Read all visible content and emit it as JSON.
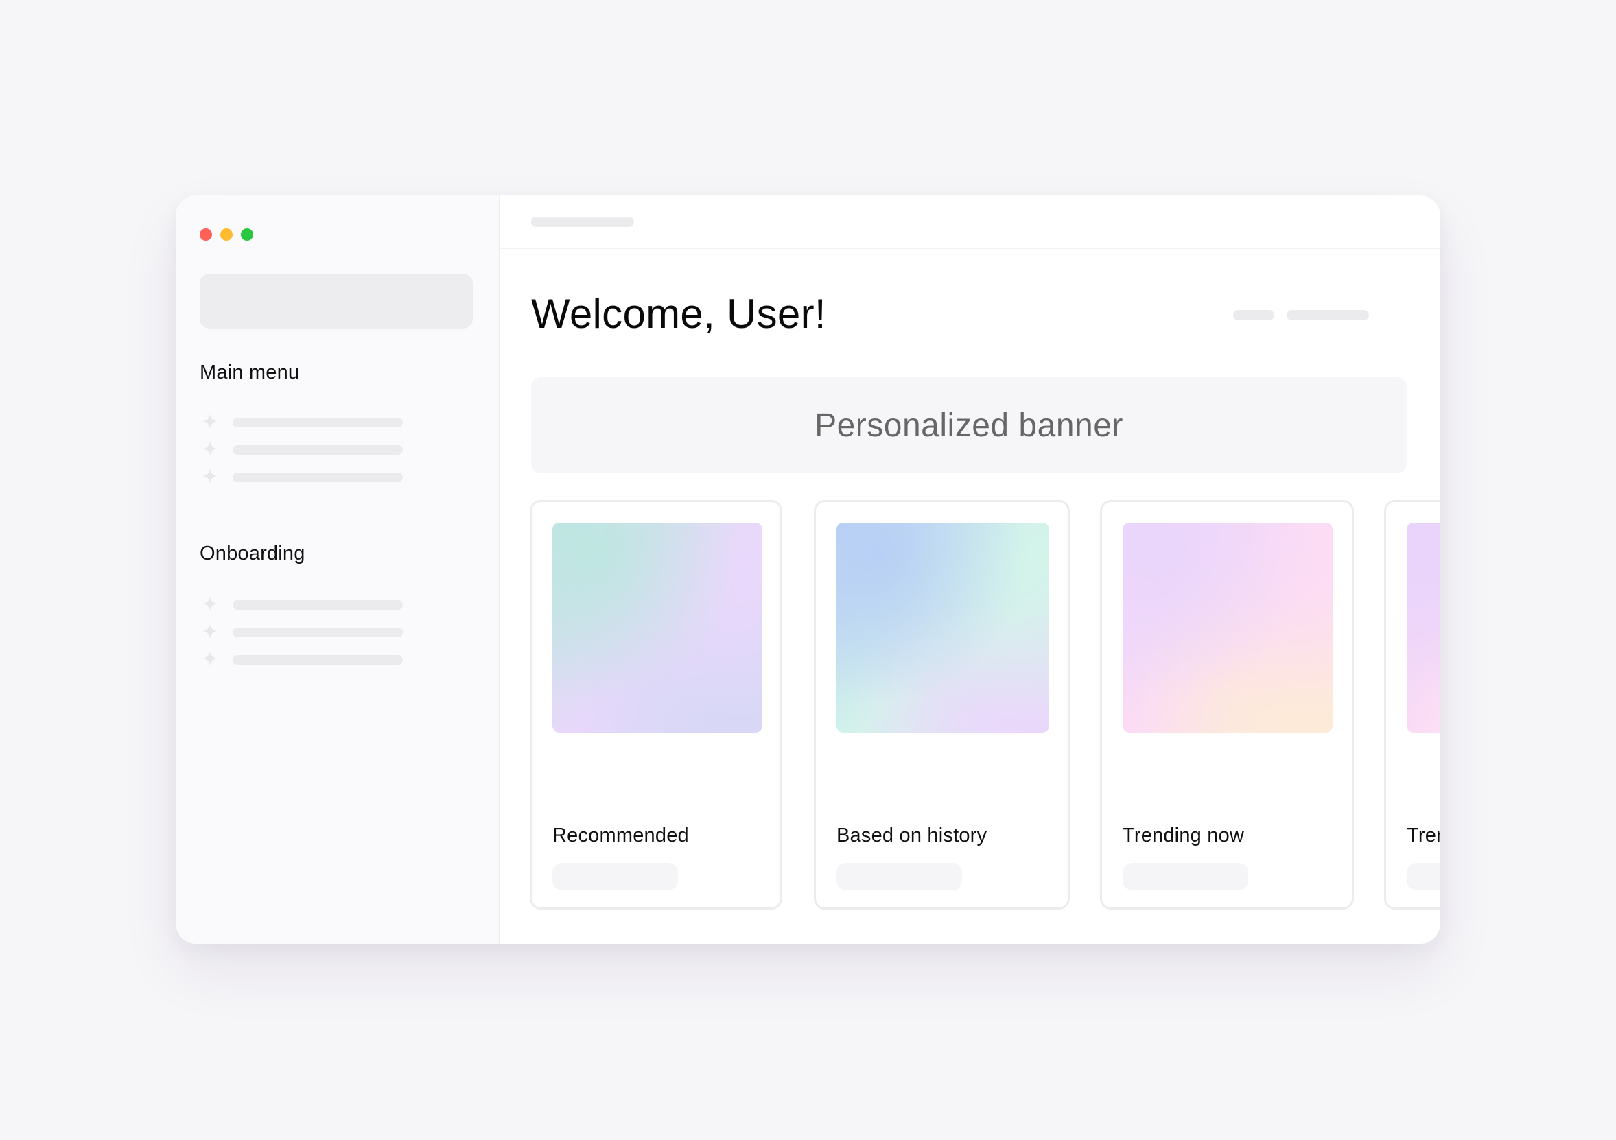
{
  "window": {
    "controls": {
      "close_color": "#ff6159",
      "minimize_color": "#fdbc2f",
      "zoom_color": "#2ac840"
    }
  },
  "sidebar": {
    "sections": [
      {
        "title": "Main menu",
        "items": [
          {
            "icon": "sparkle-icon"
          },
          {
            "icon": "sparkle-icon"
          },
          {
            "icon": "sparkle-icon"
          }
        ]
      },
      {
        "title": "Onboarding",
        "items": [
          {
            "icon": "sparkle-icon"
          },
          {
            "icon": "sparkle-icon"
          },
          {
            "icon": "sparkle-icon"
          }
        ]
      }
    ]
  },
  "main": {
    "title": "Welcome, User!",
    "banner": "Personalized banner",
    "cards": [
      {
        "label": "Recommended",
        "gradient": [
          "#bfe6e2",
          "#e9d8fb",
          "#d8d8f6"
        ]
      },
      {
        "label": "Based on history",
        "gradient": [
          "#b8d0f5",
          "#d3f4ea",
          "#ead8fb"
        ]
      },
      {
        "label": "Trending now",
        "gradient": [
          "#ead6fb",
          "#fcdcf5",
          "#fdebd8"
        ]
      },
      {
        "label": "Trending now",
        "gradient": [
          "#e9d4fb",
          "#fcdcf5",
          "#fde6f4"
        ]
      }
    ]
  }
}
